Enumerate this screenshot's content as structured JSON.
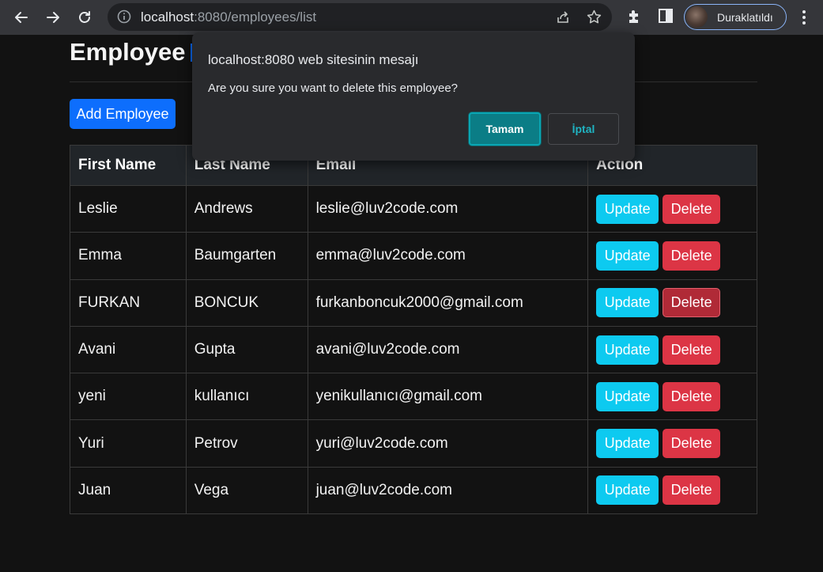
{
  "browser": {
    "url_host": "localhost",
    "url_rest": ":8080/employees/list",
    "profile_name": "Duraklatıldı"
  },
  "page": {
    "title": "Employee",
    "add_button": "Add Employee"
  },
  "table": {
    "headers": [
      "First Name",
      "Last Name",
      "Email",
      "Action"
    ],
    "update_label": "Update",
    "delete_label": "Delete",
    "rows": [
      {
        "first": "Leslie",
        "last": "Andrews",
        "email": "leslie@luv2code.com"
      },
      {
        "first": "Emma",
        "last": "Baumgarten",
        "email": "emma@luv2code.com"
      },
      {
        "first": "FURKAN",
        "last": "BONCUK",
        "email": "furkanboncuk2000@gmail.com"
      },
      {
        "first": "Avani",
        "last": "Gupta",
        "email": "avani@luv2code.com"
      },
      {
        "first": "yeni",
        "last": "kullanıcı",
        "email": "yenikullanıcı@gmail.com"
      },
      {
        "first": "Yuri",
        "last": "Petrov",
        "email": "yuri@luv2code.com"
      },
      {
        "first": "Juan",
        "last": "Vega",
        "email": "juan@luv2code.com"
      }
    ]
  },
  "dialog": {
    "title": "localhost:8080 web sitesinin mesajı",
    "message": "Are you sure you want to delete this employee?",
    "ok_label": "Tamam",
    "cancel_label": "İptal"
  },
  "colors": {
    "primary": "#0d6efd",
    "info": "#0dcaf0",
    "danger": "#dc3545",
    "dialog_ok": "#0b7d86"
  },
  "icons": [
    "back-arrow-icon",
    "forward-arrow-icon",
    "reload-icon",
    "info-icon",
    "share-icon",
    "star-icon",
    "extensions-icon",
    "side-panel-icon",
    "kebab-menu-icon"
  ]
}
